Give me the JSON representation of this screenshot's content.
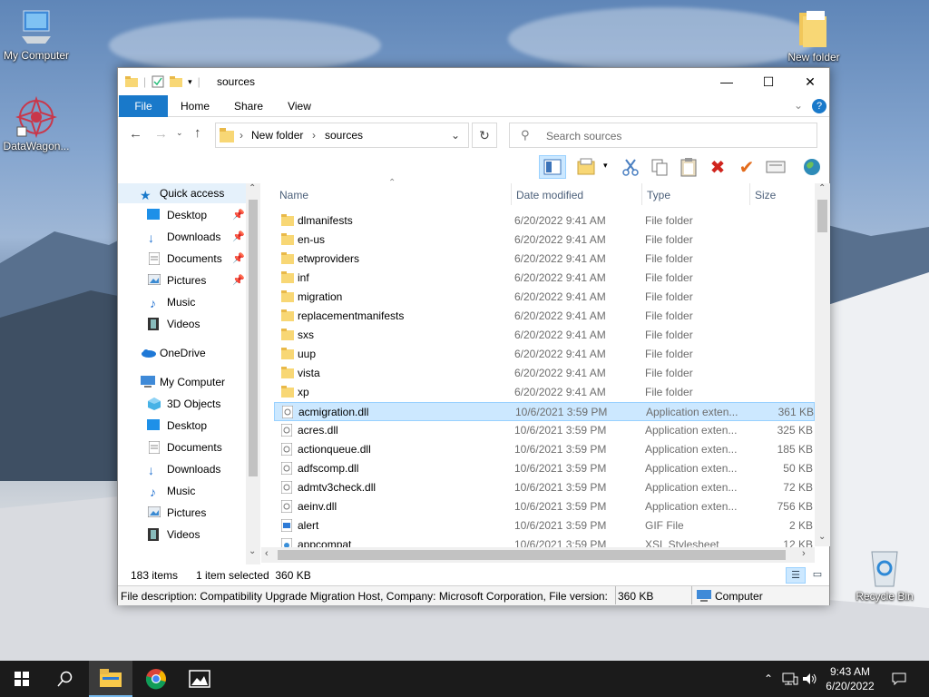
{
  "desktop": {
    "icons": [
      {
        "label": "My Computer"
      },
      {
        "label": "DataWagon..."
      },
      {
        "label": "New folder"
      },
      {
        "label": "Recycle Bin"
      }
    ]
  },
  "window": {
    "title": "sources",
    "ribbon_tabs": [
      "File",
      "Home",
      "Share",
      "View"
    ],
    "breadcrumb": [
      "New folder",
      "sources"
    ],
    "search_placeholder": "Search sources",
    "nav": {
      "quick_access": "Quick access",
      "quick_items": [
        "Desktop",
        "Downloads",
        "Documents",
        "Pictures",
        "Music",
        "Videos"
      ],
      "onedrive": "OneDrive",
      "my_computer": "My Computer",
      "computer_items": [
        "3D Objects",
        "Desktop",
        "Documents",
        "Downloads",
        "Music",
        "Pictures",
        "Videos"
      ]
    },
    "columns": {
      "name": "Name",
      "date": "Date modified",
      "type": "Type",
      "size": "Size"
    },
    "files": [
      {
        "name": "dlmanifests",
        "date": "6/20/2022 9:41 AM",
        "type": "File folder",
        "size": "",
        "kind": "folder"
      },
      {
        "name": "en-us",
        "date": "6/20/2022 9:41 AM",
        "type": "File folder",
        "size": "",
        "kind": "folder"
      },
      {
        "name": "etwproviders",
        "date": "6/20/2022 9:41 AM",
        "type": "File folder",
        "size": "",
        "kind": "folder"
      },
      {
        "name": "inf",
        "date": "6/20/2022 9:41 AM",
        "type": "File folder",
        "size": "",
        "kind": "folder"
      },
      {
        "name": "migration",
        "date": "6/20/2022 9:41 AM",
        "type": "File folder",
        "size": "",
        "kind": "folder"
      },
      {
        "name": "replacementmanifests",
        "date": "6/20/2022 9:41 AM",
        "type": "File folder",
        "size": "",
        "kind": "folder"
      },
      {
        "name": "sxs",
        "date": "6/20/2022 9:41 AM",
        "type": "File folder",
        "size": "",
        "kind": "folder"
      },
      {
        "name": "uup",
        "date": "6/20/2022 9:41 AM",
        "type": "File folder",
        "size": "",
        "kind": "folder"
      },
      {
        "name": "vista",
        "date": "6/20/2022 9:41 AM",
        "type": "File folder",
        "size": "",
        "kind": "folder"
      },
      {
        "name": "xp",
        "date": "6/20/2022 9:41 AM",
        "type": "File folder",
        "size": "",
        "kind": "folder"
      },
      {
        "name": "acmigration.dll",
        "date": "10/6/2021 3:59 PM",
        "type": "Application exten...",
        "size": "361 KB",
        "kind": "dll",
        "selected": true
      },
      {
        "name": "acres.dll",
        "date": "10/6/2021 3:59 PM",
        "type": "Application exten...",
        "size": "325 KB",
        "kind": "dll"
      },
      {
        "name": "actionqueue.dll",
        "date": "10/6/2021 3:59 PM",
        "type": "Application exten...",
        "size": "185 KB",
        "kind": "dll"
      },
      {
        "name": "adfscomp.dll",
        "date": "10/6/2021 3:59 PM",
        "type": "Application exten...",
        "size": "50 KB",
        "kind": "dll"
      },
      {
        "name": "admtv3check.dll",
        "date": "10/6/2021 3:59 PM",
        "type": "Application exten...",
        "size": "72 KB",
        "kind": "dll"
      },
      {
        "name": "aeinv.dll",
        "date": "10/6/2021 3:59 PM",
        "type": "Application exten...",
        "size": "756 KB",
        "kind": "dll"
      },
      {
        "name": "alert",
        "date": "10/6/2021 3:59 PM",
        "type": "GIF File",
        "size": "2 KB",
        "kind": "gif"
      },
      {
        "name": "appcompat",
        "date": "10/6/2021 3:59 PM",
        "type": "XSL Stylesheet",
        "size": "12 KB",
        "kind": "xsl"
      }
    ],
    "status": {
      "count": "183 items",
      "selection": "1 item selected  360 KB",
      "description": "File description: Compatibility Upgrade Migration Host, Company: Microsoft Corporation, File version:",
      "desc_size": "360 KB",
      "location": "Computer"
    }
  },
  "taskbar": {
    "time": "9:43 AM",
    "date": "6/20/2022"
  },
  "colors": {
    "accent": "#1979ca",
    "selection": "#cce8ff",
    "folder": "#f8d775",
    "taskbar": "#1b1b1b"
  }
}
